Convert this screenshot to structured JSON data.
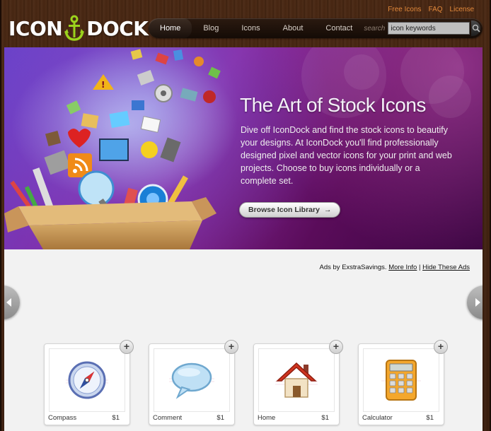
{
  "top_links": [
    "Free Icons",
    "FAQ",
    "License"
  ],
  "logo": {
    "left": "ICON",
    "right": "DOCK"
  },
  "nav": {
    "items": [
      "Home",
      "Blog",
      "Icons",
      "About",
      "Contact"
    ],
    "active": "Home",
    "search_label": "search",
    "search_value": "icon keywords"
  },
  "hero": {
    "title": "The Art of Stock Icons",
    "description": "Dive off IconDock and find the stock icons to beautify your designs. At IconDock you'll find professionally designed pixel and vector icons for your print and web projects. Choose to buy icons individually or a complete set.",
    "button_label": "Browse Icon Library"
  },
  "ads": {
    "prefix": "Ads by ExstraSavings.",
    "more_info": "More Info",
    "separator": "|",
    "hide": "Hide These Ads"
  },
  "products": [
    {
      "name": "Compass",
      "price": "$1",
      "icon": "compass-icon"
    },
    {
      "name": "Comment",
      "price": "$1",
      "icon": "comment-icon"
    },
    {
      "name": "Home",
      "price": "$1",
      "icon": "home-icon"
    },
    {
      "name": "Calculator",
      "price": "$1",
      "icon": "calculator-icon"
    }
  ],
  "colors": {
    "accent_orange": "#e2893b",
    "logo_anchor": "#9bd31d",
    "hero_purple": "#6a2a9a"
  }
}
